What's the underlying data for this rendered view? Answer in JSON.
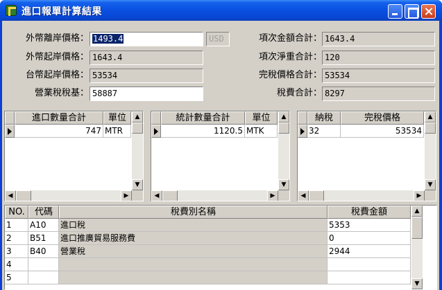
{
  "window": {
    "title": "進口報單計算結果"
  },
  "form": {
    "left": [
      {
        "label": "外幣離岸價格：",
        "value": "1493.4"
      },
      {
        "label": "外幣起岸價格：",
        "value": "1643.4"
      },
      {
        "label": "台幣起岸價格：",
        "value": "53534"
      },
      {
        "label": "營業稅稅基：",
        "value": "58887"
      }
    ],
    "currency": "USD",
    "right": [
      {
        "label": "項次金額合計：",
        "value": "1643.4"
      },
      {
        "label": "項次淨重合計：",
        "value": "120"
      },
      {
        "label": "完稅價格合計：",
        "value": "53534"
      },
      {
        "label": "稅費合計：",
        "value": "8297"
      }
    ]
  },
  "grid1": {
    "headers": [
      "進口數量合計",
      "單位"
    ],
    "rows": [
      {
        "qty": "747",
        "unit": "MTR"
      }
    ]
  },
  "grid2": {
    "headers": [
      "統計數量合計",
      "單位"
    ],
    "rows": [
      {
        "qty": "1120.5",
        "unit": "MTK"
      }
    ]
  },
  "grid3": {
    "headers": [
      "納稅",
      "完稅價格"
    ],
    "rows": [
      {
        "tax": "32",
        "price": "53534"
      }
    ]
  },
  "feeGrid": {
    "headers": [
      "NO.",
      "代碼",
      "稅費別名稱",
      "稅費金額"
    ],
    "rows": [
      {
        "no": "1",
        "code": "A10",
        "name": "進口稅",
        "amount": "5353"
      },
      {
        "no": "2",
        "code": "B51",
        "name": "進口推廣貿易服務費",
        "amount": "0"
      },
      {
        "no": "3",
        "code": "B40",
        "name": "營業稅",
        "amount": "2944"
      },
      {
        "no": "4",
        "code": "",
        "name": "",
        "amount": ""
      },
      {
        "no": "5",
        "code": "",
        "name": "",
        "amount": ""
      }
    ]
  }
}
